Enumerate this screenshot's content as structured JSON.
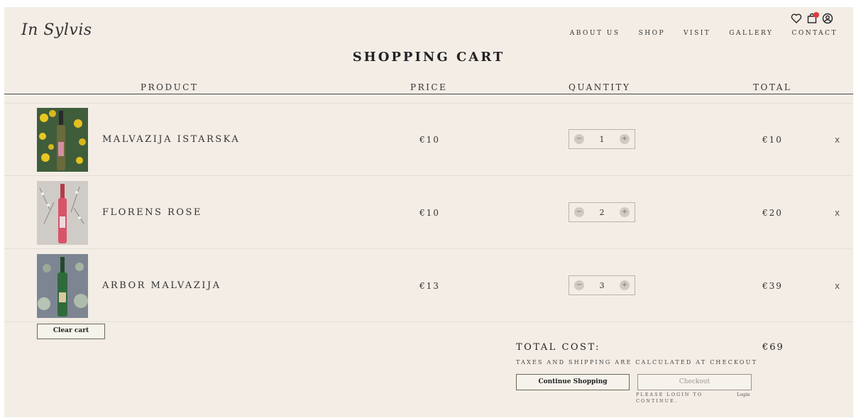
{
  "brand": {
    "logo": "In Sylvis"
  },
  "nav": [
    "ABOUT US",
    "SHOP",
    "VISIT",
    "GALLERY",
    "CONTACT"
  ],
  "icons": [
    "heart-icon",
    "shopping-bag-icon",
    "user-icon"
  ],
  "cart": {
    "title": "SHOPPING CART",
    "headers": {
      "product": "PRODUCT",
      "price": "PRICE",
      "quantity": "QUANTITY",
      "total": "TOTAL"
    },
    "items": [
      {
        "name": "MALVAZIJA ISTARSKA",
        "price": "€10",
        "quantity": "1",
        "total": "€10",
        "remove": "x"
      },
      {
        "name": "FLORENS ROSE",
        "price": "€10",
        "quantity": "2",
        "total": "€20",
        "remove": "x"
      },
      {
        "name": "ARBOR MALVAZIJA",
        "price": "€13",
        "quantity": "3",
        "total": "€39",
        "remove": "x"
      }
    ],
    "qty_minus": "−",
    "qty_plus": "+",
    "clear_label": "Clear cart",
    "total_label": "TOTAL COST:",
    "total_value": "€69",
    "taxes_note": "TAXES AND SHIPPING ARE CALCULATED AT CHECKOUT",
    "continue_label": "Continue Shopping",
    "checkout_label": "Checkout",
    "login_note": "PLEASE LOGIN TO CONTINUE.",
    "login_link": "Login"
  },
  "colors": {
    "background": "#f3ede6",
    "badge": "#e03b3b",
    "button_border": "#6a6a55"
  }
}
